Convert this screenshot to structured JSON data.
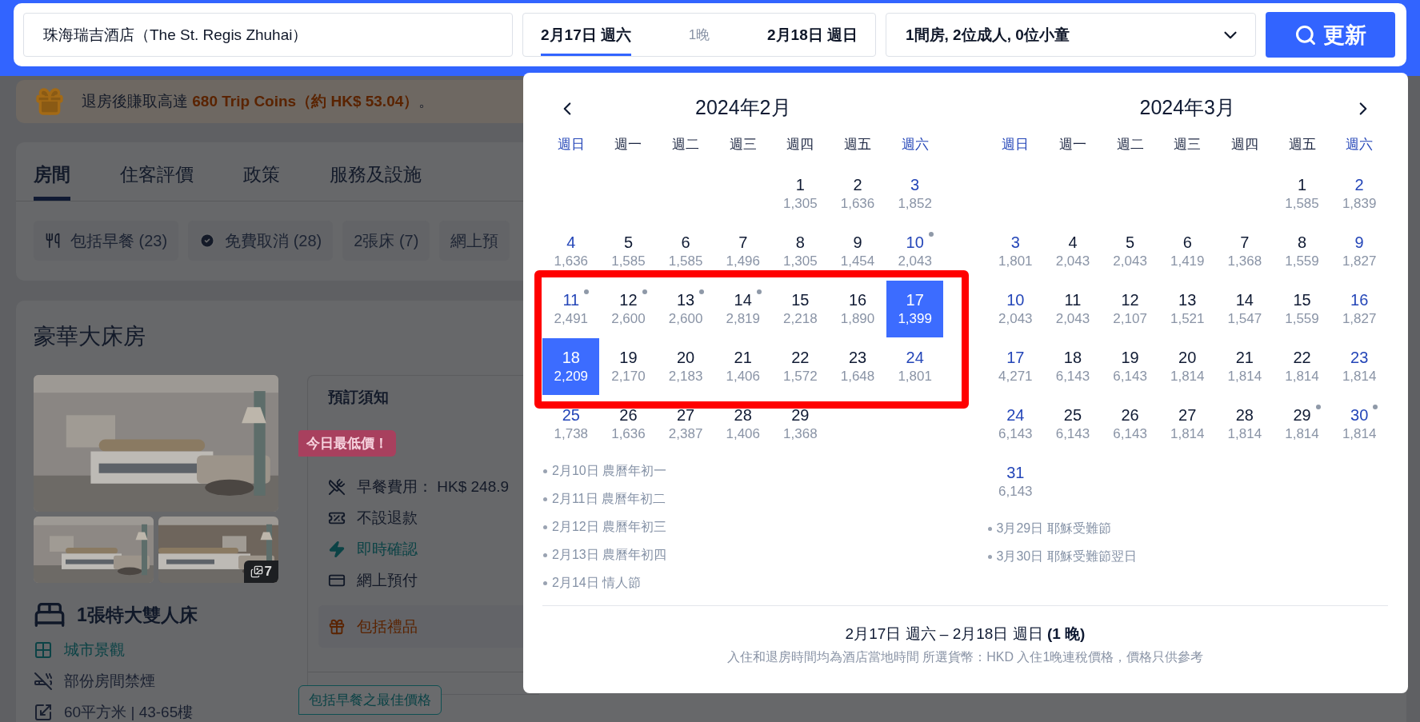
{
  "search_bar": {
    "hotel": "珠海瑞吉酒店（The St. Regis Zhuhai）",
    "check_in": {
      "text": "2月17日 週六",
      "selected": true
    },
    "nights": "1晚",
    "check_out": {
      "text": "2月18日 週日",
      "selected": false
    },
    "guests": "1間房, 2位成人, 0位小童",
    "button": "更新"
  },
  "coins_banner": {
    "text": "退房後賺取高達 ",
    "highlight": "680 Trip Coins（約 HK$ 53.04）",
    "suffix": "。"
  },
  "tabs": [
    {
      "label": "房間",
      "selected": true
    },
    {
      "label": "住客評價",
      "selected": false
    },
    {
      "label": "政策",
      "selected": false
    },
    {
      "label": "服務及設施",
      "selected": false
    }
  ],
  "filters": [
    {
      "kind": "meal",
      "label": "包括早餐 (23)"
    },
    {
      "kind": "check",
      "label": "免費取消 (28)"
    },
    {
      "kind": "plain",
      "label": "2張床 (7)"
    },
    {
      "kind": "plain",
      "label": "網上預"
    }
  ],
  "room": {
    "title": "豪華大床房",
    "photo_count": "7",
    "bed": "1張特大雙人床",
    "features": [
      {
        "kind": "view",
        "text": "城市景觀"
      },
      {
        "kind": "smoking",
        "text": "部份房間禁煙"
      },
      {
        "kind": "area",
        "text": "60平方米 | 43-65樓"
      }
    ]
  },
  "booking_notice": {
    "title": "預訂須知",
    "badge": "今日最低價！",
    "items": [
      {
        "kind": "meal",
        "text": "早餐費用： HK$ 248.9"
      },
      {
        "kind": "refund",
        "text": "不設退款"
      },
      {
        "kind": "instant",
        "text": "即時確認"
      },
      {
        "kind": "prepay",
        "text": "網上預付"
      },
      {
        "kind": "gift",
        "text": "包括禮品"
      }
    ],
    "best_price_tag": "包括早餐之最佳價格"
  },
  "calendar": {
    "months": [
      {
        "title": "2024年2月",
        "kind": "prev",
        "weekdays": [
          "週日",
          "週一",
          "週二",
          "週三",
          "週四",
          "週五",
          "週六"
        ],
        "weeks": [
          {
            "framed": false,
            "days": [
              {
                "kind": "blank"
              },
              {
                "kind": "blank"
              },
              {
                "kind": "blank"
              },
              {
                "kind": "blank"
              },
              {
                "kind": "day",
                "day": "1",
                "price": "1,305",
                "holiday": false,
                "selected": false
              },
              {
                "kind": "day",
                "day": "2",
                "price": "1,636",
                "holiday": false,
                "selected": false
              },
              {
                "kind": "day",
                "day": "3",
                "price": "1,852",
                "holiday": false,
                "selected": false
              }
            ]
          },
          {
            "framed": false,
            "days": [
              {
                "kind": "day",
                "day": "4",
                "price": "1,636",
                "holiday": false,
                "selected": false
              },
              {
                "kind": "day",
                "day": "5",
                "price": "1,585",
                "holiday": false,
                "selected": false
              },
              {
                "kind": "day",
                "day": "6",
                "price": "1,585",
                "holiday": false,
                "selected": false
              },
              {
                "kind": "day",
                "day": "7",
                "price": "1,496",
                "holiday": false,
                "selected": false
              },
              {
                "kind": "day",
                "day": "8",
                "price": "1,305",
                "holiday": false,
                "selected": false
              },
              {
                "kind": "day",
                "day": "9",
                "price": "1,454",
                "holiday": false,
                "selected": false
              },
              {
                "kind": "day",
                "day": "10",
                "price": "2,043",
                "holiday": true,
                "selected": false
              }
            ]
          },
          {
            "framed": true,
            "days": [
              {
                "kind": "day",
                "day": "11",
                "price": "2,491",
                "holiday": true,
                "selected": false
              },
              {
                "kind": "day",
                "day": "12",
                "price": "2,600",
                "holiday": true,
                "selected": false
              },
              {
                "kind": "day",
                "day": "13",
                "price": "2,600",
                "holiday": true,
                "selected": false
              },
              {
                "kind": "day",
                "day": "14",
                "price": "2,819",
                "holiday": true,
                "selected": false
              },
              {
                "kind": "day",
                "day": "15",
                "price": "2,218",
                "holiday": false,
                "selected": false
              },
              {
                "kind": "day",
                "day": "16",
                "price": "1,890",
                "holiday": false,
                "selected": false
              },
              {
                "kind": "day",
                "day": "17",
                "price": "1,399",
                "holiday": false,
                "selected": true
              }
            ]
          },
          {
            "framed": true,
            "days": [
              {
                "kind": "day",
                "day": "18",
                "price": "2,209",
                "holiday": false,
                "selected": true
              },
              {
                "kind": "day",
                "day": "19",
                "price": "2,170",
                "holiday": false,
                "selected": false
              },
              {
                "kind": "day",
                "day": "20",
                "price": "2,183",
                "holiday": false,
                "selected": false
              },
              {
                "kind": "day",
                "day": "21",
                "price": "1,406",
                "holiday": false,
                "selected": false
              },
              {
                "kind": "day",
                "day": "22",
                "price": "1,572",
                "holiday": false,
                "selected": false
              },
              {
                "kind": "day",
                "day": "23",
                "price": "1,648",
                "holiday": false,
                "selected": false
              },
              {
                "kind": "day",
                "day": "24",
                "price": "1,801",
                "holiday": false,
                "selected": false
              }
            ]
          },
          {
            "framed": false,
            "days": [
              {
                "kind": "day",
                "day": "25",
                "price": "1,738",
                "holiday": false,
                "selected": false
              },
              {
                "kind": "day",
                "day": "26",
                "price": "1,636",
                "holiday": false,
                "selected": false
              },
              {
                "kind": "day",
                "day": "27",
                "price": "2,387",
                "holiday": false,
                "selected": false
              },
              {
                "kind": "day",
                "day": "28",
                "price": "1,406",
                "holiday": false,
                "selected": false
              },
              {
                "kind": "day",
                "day": "29",
                "price": "1,368",
                "holiday": false,
                "selected": false
              }
            ]
          }
        ],
        "holidays": [
          "2月10日 農曆年初一",
          "2月11日 農曆年初二",
          "2月12日 農曆年初三",
          "2月13日 農曆年初四",
          "2月14日 情人節"
        ]
      },
      {
        "title": "2024年3月",
        "kind": "next",
        "weekdays": [
          "週日",
          "週一",
          "週二",
          "週三",
          "週四",
          "週五",
          "週六"
        ],
        "weeks": [
          {
            "framed": false,
            "days": [
              {
                "kind": "blank"
              },
              {
                "kind": "blank"
              },
              {
                "kind": "blank"
              },
              {
                "kind": "blank"
              },
              {
                "kind": "blank"
              },
              {
                "kind": "day",
                "day": "1",
                "price": "1,585",
                "holiday": false,
                "selected": false
              },
              {
                "kind": "day",
                "day": "2",
                "price": "1,839",
                "holiday": false,
                "selected": false
              }
            ]
          },
          {
            "framed": false,
            "days": [
              {
                "kind": "day",
                "day": "3",
                "price": "1,801",
                "holiday": false,
                "selected": false
              },
              {
                "kind": "day",
                "day": "4",
                "price": "2,043",
                "holiday": false,
                "selected": false
              },
              {
                "kind": "day",
                "day": "5",
                "price": "2,043",
                "holiday": false,
                "selected": false
              },
              {
                "kind": "day",
                "day": "6",
                "price": "1,419",
                "holiday": false,
                "selected": false
              },
              {
                "kind": "day",
                "day": "7",
                "price": "1,368",
                "holiday": false,
                "selected": false
              },
              {
                "kind": "day",
                "day": "8",
                "price": "1,559",
                "holiday": false,
                "selected": false
              },
              {
                "kind": "day",
                "day": "9",
                "price": "1,827",
                "holiday": false,
                "selected": false
              }
            ]
          },
          {
            "framed": false,
            "days": [
              {
                "kind": "day",
                "day": "10",
                "price": "2,043",
                "holiday": false,
                "selected": false
              },
              {
                "kind": "day",
                "day": "11",
                "price": "2,043",
                "holiday": false,
                "selected": false
              },
              {
                "kind": "day",
                "day": "12",
                "price": "2,107",
                "holiday": false,
                "selected": false
              },
              {
                "kind": "day",
                "day": "13",
                "price": "1,521",
                "holiday": false,
                "selected": false
              },
              {
                "kind": "day",
                "day": "14",
                "price": "1,547",
                "holiday": false,
                "selected": false
              },
              {
                "kind": "day",
                "day": "15",
                "price": "1,559",
                "holiday": false,
                "selected": false
              },
              {
                "kind": "day",
                "day": "16",
                "price": "1,827",
                "holiday": false,
                "selected": false
              }
            ]
          },
          {
            "framed": false,
            "days": [
              {
                "kind": "day",
                "day": "17",
                "price": "4,271",
                "holiday": false,
                "selected": false
              },
              {
                "kind": "day",
                "day": "18",
                "price": "6,143",
                "holiday": false,
                "selected": false
              },
              {
                "kind": "day",
                "day": "19",
                "price": "6,143",
                "holiday": false,
                "selected": false
              },
              {
                "kind": "day",
                "day": "20",
                "price": "1,814",
                "holiday": false,
                "selected": false
              },
              {
                "kind": "day",
                "day": "21",
                "price": "1,814",
                "holiday": false,
                "selected": false
              },
              {
                "kind": "day",
                "day": "22",
                "price": "1,814",
                "holiday": false,
                "selected": false
              },
              {
                "kind": "day",
                "day": "23",
                "price": "1,814",
                "holiday": false,
                "selected": false
              }
            ]
          },
          {
            "framed": false,
            "days": [
              {
                "kind": "day",
                "day": "24",
                "price": "6,143",
                "holiday": false,
                "selected": false
              },
              {
                "kind": "day",
                "day": "25",
                "price": "6,143",
                "holiday": false,
                "selected": false
              },
              {
                "kind": "day",
                "day": "26",
                "price": "6,143",
                "holiday": false,
                "selected": false
              },
              {
                "kind": "day",
                "day": "27",
                "price": "1,814",
                "holiday": false,
                "selected": false
              },
              {
                "kind": "day",
                "day": "28",
                "price": "1,814",
                "holiday": false,
                "selected": false
              },
              {
                "kind": "day",
                "day": "29",
                "price": "1,814",
                "holiday": true,
                "selected": false
              },
              {
                "kind": "day",
                "day": "30",
                "price": "1,814",
                "holiday": true,
                "selected": false
              }
            ]
          },
          {
            "framed": false,
            "days": [
              {
                "kind": "day",
                "day": "31",
                "price": "6,143",
                "holiday": false,
                "selected": false
              }
            ]
          }
        ],
        "holidays": [
          "3月29日 耶穌受難節",
          "3月30日 耶穌受難節翌日"
        ]
      }
    ],
    "summary": "2月17日 週六 – 2月18日 週日 **(1 晚)**",
    "note": "入住和退房時間均為酒店當地時間 所選貨幣：HKD 入住1晚連稅價格，價格只供參考"
  }
}
